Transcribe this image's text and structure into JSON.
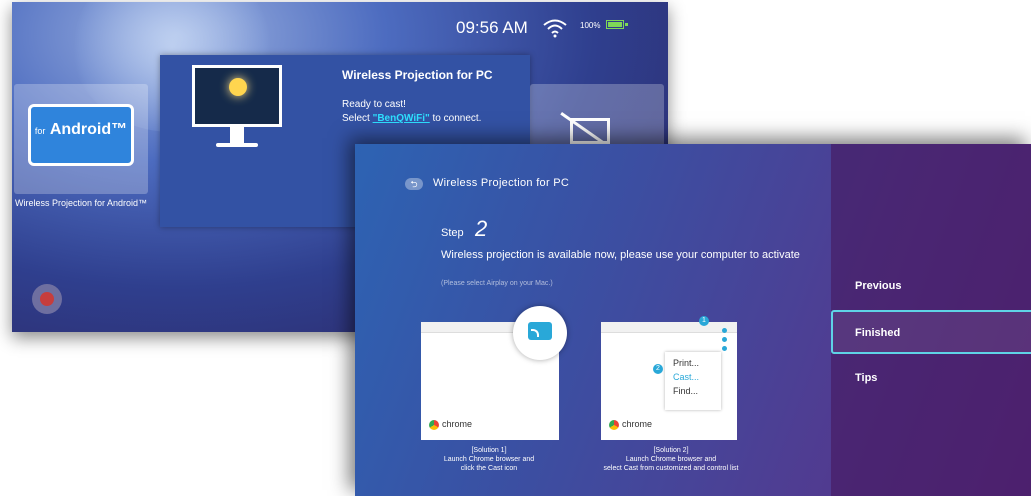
{
  "back_screen": {
    "status": {
      "time": "09:56 AM",
      "battery_text": "100%",
      "icons": [
        "wifi-icon",
        "battery-icon"
      ]
    },
    "android_tile": {
      "for_text": "for",
      "android_text": "Android™",
      "caption": "Wireless Projection for Android™"
    },
    "pc_card": {
      "title": "Wireless Projection for PC",
      "line1": "Ready to cast!",
      "line2_prefix": "Select ",
      "ssid": "\"BenQWiFi\"",
      "line2_suffix": " to connect."
    }
  },
  "front_screen": {
    "header": {
      "title": "Wireless Projection for PC"
    },
    "step": {
      "label": "Step",
      "number": "2"
    },
    "instruction": "Wireless projection is available now, please use your computer to activate",
    "sub_instruction": "(Please select Airplay on your Mac.)",
    "solution1": {
      "browser": "chrome",
      "caption_line1": "[Solution 1]",
      "caption_line2": "Launch Chrome browser and",
      "caption_line3": "click the Cast icon"
    },
    "solution2": {
      "browser": "chrome",
      "menu_items": [
        "Print...",
        "Cast...",
        "Find..."
      ],
      "badge1": "1",
      "badge2": "2",
      "caption_line1": "[Solution 2]",
      "caption_line2": "Launch Chrome browser and",
      "caption_line3": "select Cast from customized and control list"
    },
    "menu": {
      "items": [
        "Previous",
        "Finished",
        "Tips"
      ],
      "selected": "Finished"
    }
  },
  "colors": {
    "accent_cyan": "#29a8d8",
    "highlight_border": "#5fd3e6",
    "battery_green": "#7ed957"
  }
}
